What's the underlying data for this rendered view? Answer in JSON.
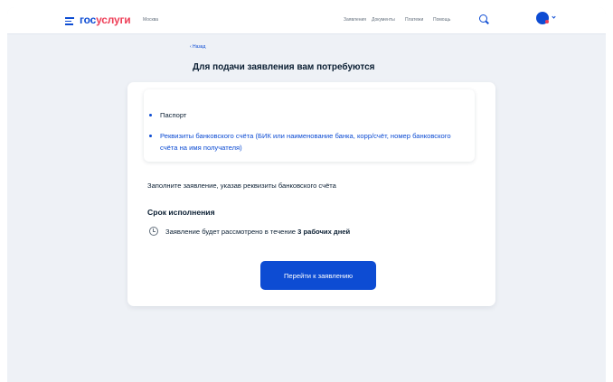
{
  "header": {
    "logo_part1": "гос",
    "logo_part2": "услуги",
    "city": "Москва",
    "nav": [
      "Заявления",
      "Документы",
      "Платежи",
      "Помощь"
    ]
  },
  "back_link": "‹ Назад",
  "page_title": "Для подачи заявления вам потребуются",
  "requirements": [
    "Паспорт",
    "Реквизиты банковского счёта (БИК или наименование банка, корр/счёт, номер банковского счёта на имя получателя)"
  ],
  "fill_instruction": "Заполните заявление, указав реквизиты банковского счёта",
  "term": {
    "title": "Срок исполнения",
    "text_prefix": "Заявление будет рассмотрено в течение ",
    "text_bold": "3 рабочих дней"
  },
  "primary_button": "Перейти к заявлению",
  "colors": {
    "brand": "#0d4cd3",
    "accent": "#ee3f58",
    "background": "#eef1f6"
  },
  "icons": [
    "menu-icon",
    "search-icon",
    "avatar-icon",
    "chevron-down-icon",
    "clock-icon"
  ]
}
